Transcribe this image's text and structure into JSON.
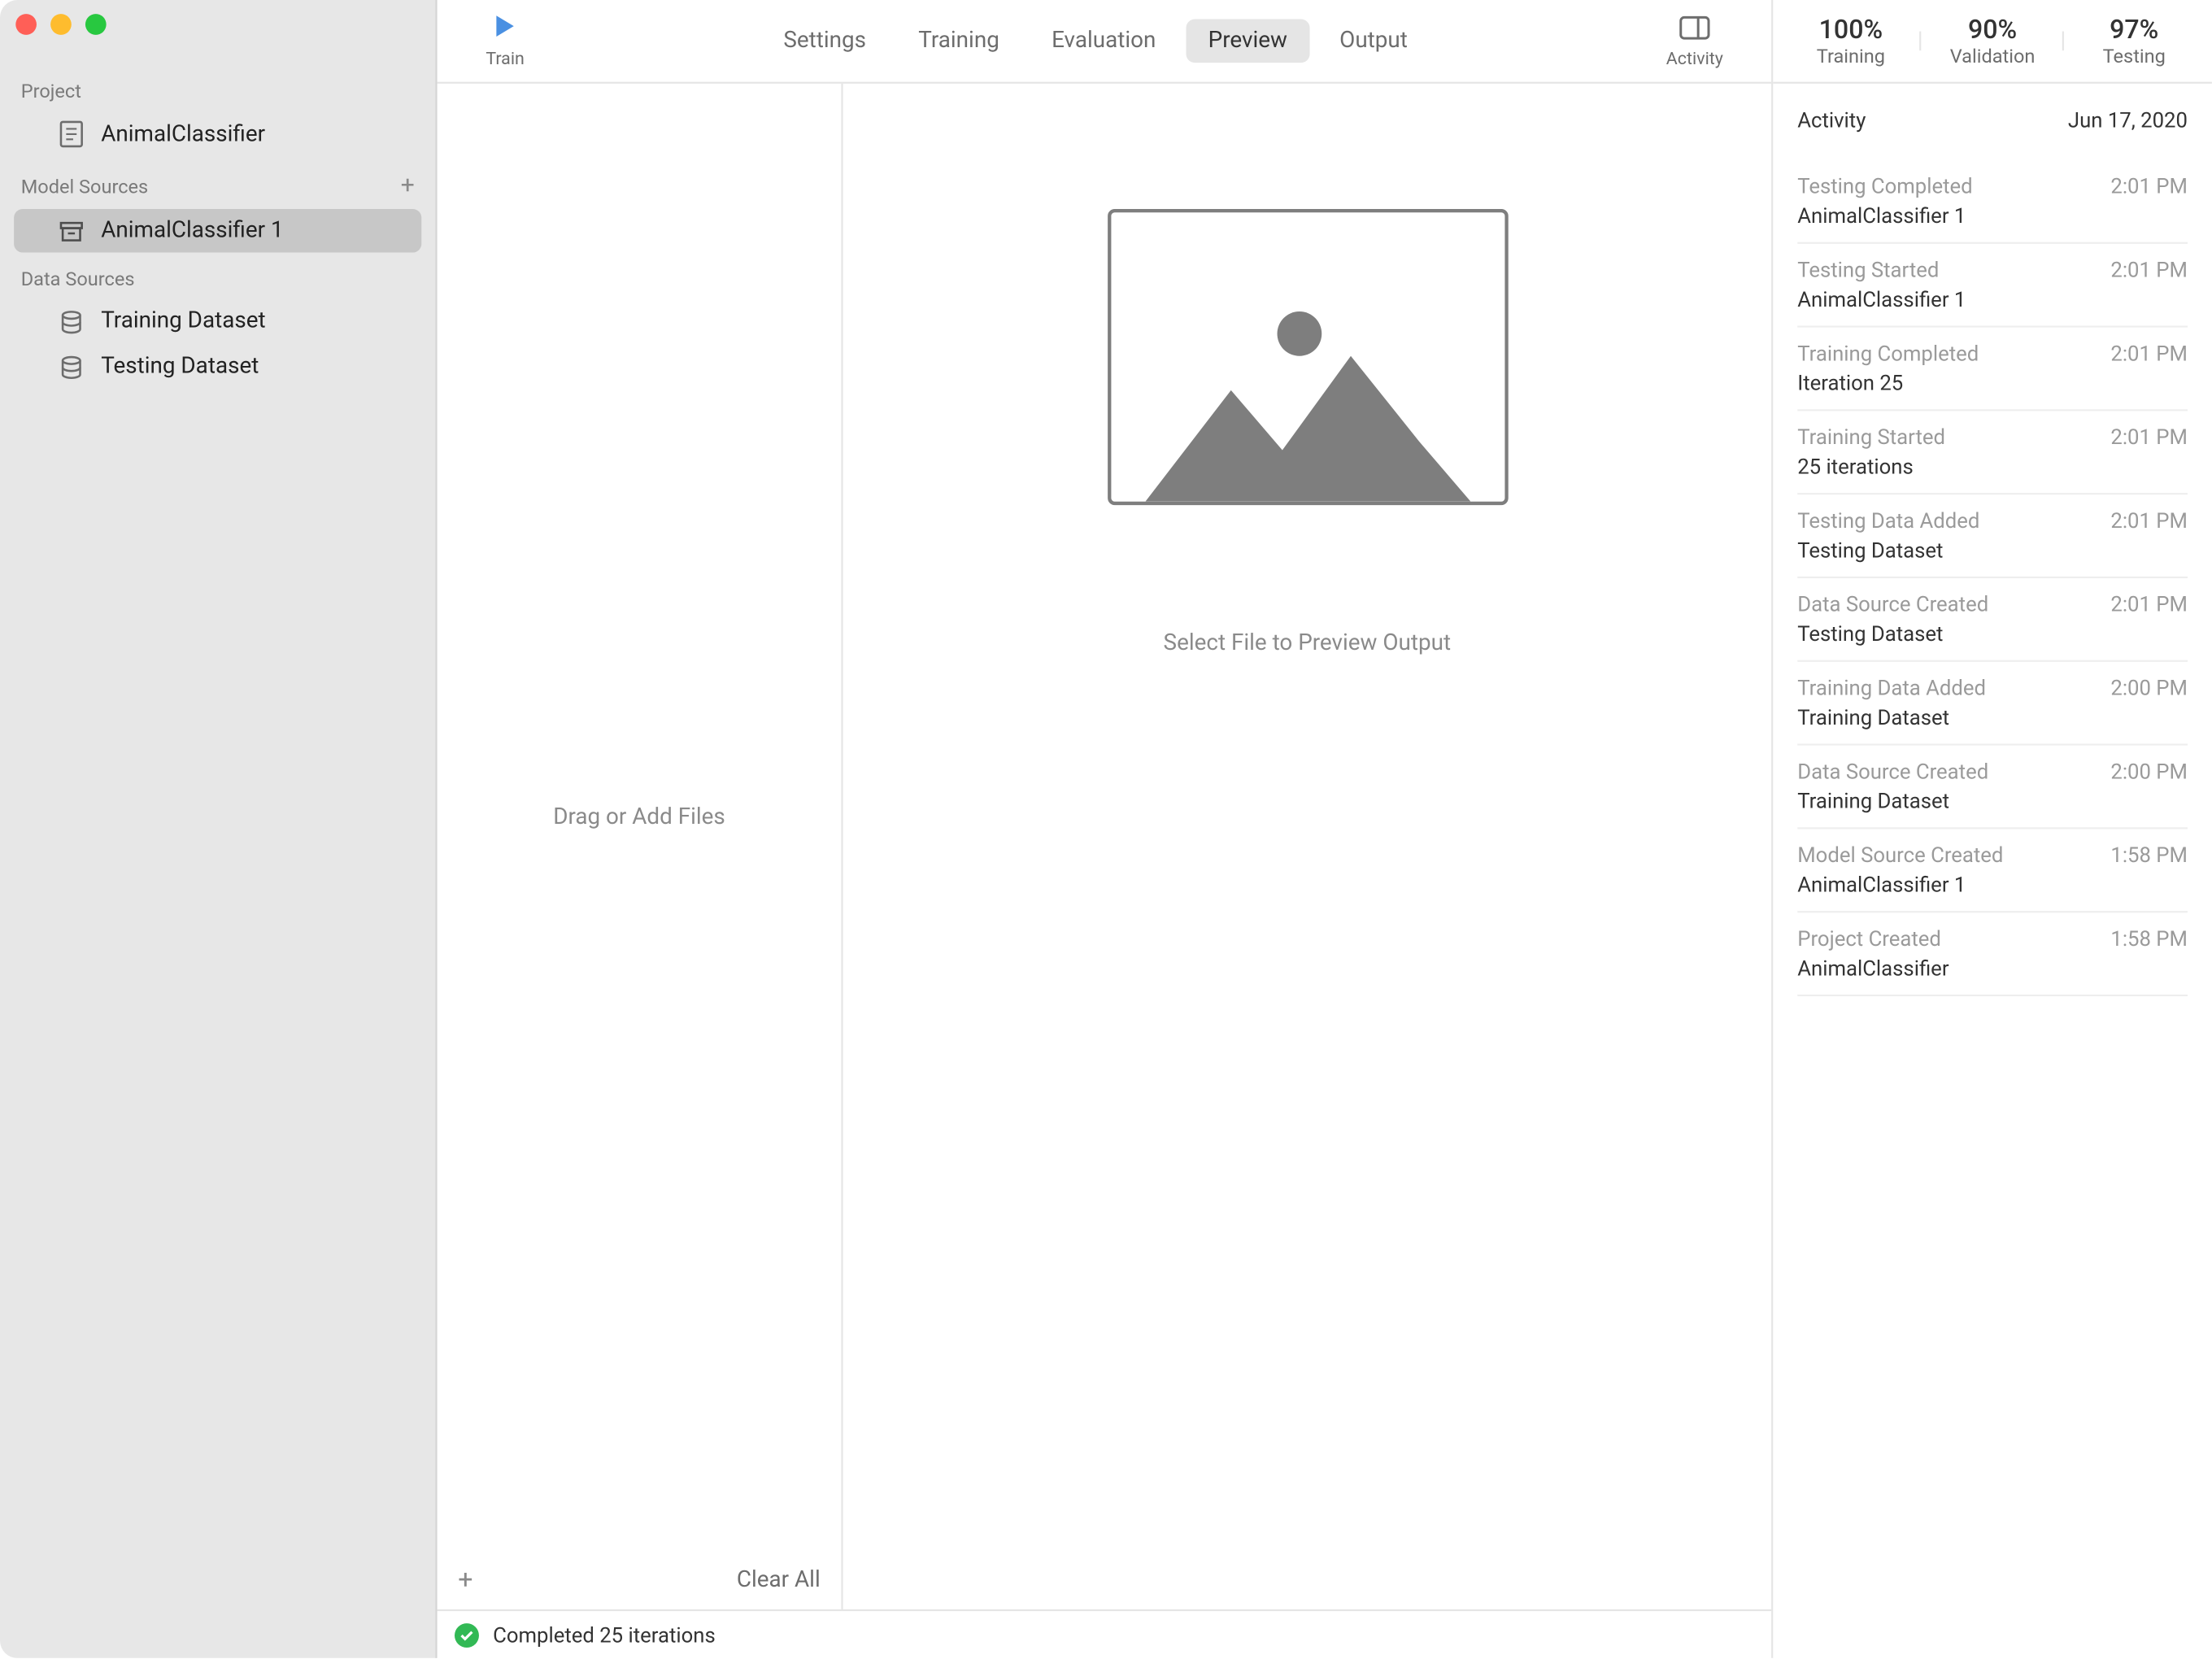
{
  "sidebar": {
    "sections": {
      "project": {
        "header": "Project",
        "item": "AnimalClassifier"
      },
      "model_sources": {
        "header": "Model Sources",
        "item": "AnimalClassifier 1"
      },
      "data_sources": {
        "header": "Data Sources",
        "items": [
          "Training Dataset",
          "Testing Dataset"
        ]
      }
    }
  },
  "toolbar": {
    "train_label": "Train",
    "tabs": [
      "Settings",
      "Training",
      "Evaluation",
      "Preview",
      "Output"
    ],
    "active_tab": "Preview",
    "activity_label": "Activity"
  },
  "drop_panel": {
    "placeholder": "Drag or Add Files",
    "clear_all": "Clear All"
  },
  "preview": {
    "placeholder_text": "Select File to Preview Output"
  },
  "metrics": [
    {
      "value": "100%",
      "label": "Training"
    },
    {
      "value": "90%",
      "label": "Validation"
    },
    {
      "value": "97%",
      "label": "Testing"
    }
  ],
  "activity": {
    "header": "Activity",
    "date": "Jun 17, 2020",
    "items": [
      {
        "title": "Testing Completed",
        "time": "2:01 PM",
        "detail": "AnimalClassifier 1"
      },
      {
        "title": "Testing Started",
        "time": "2:01 PM",
        "detail": "AnimalClassifier 1"
      },
      {
        "title": "Training Completed",
        "time": "2:01 PM",
        "detail": "Iteration 25"
      },
      {
        "title": "Training Started",
        "time": "2:01 PM",
        "detail": "25 iterations"
      },
      {
        "title": "Testing Data Added",
        "time": "2:01 PM",
        "detail": "Testing Dataset"
      },
      {
        "title": "Data Source Created",
        "time": "2:01 PM",
        "detail": "Testing Dataset"
      },
      {
        "title": "Training Data Added",
        "time": "2:00 PM",
        "detail": "Training Dataset"
      },
      {
        "title": "Data Source Created",
        "time": "2:00 PM",
        "detail": "Training Dataset"
      },
      {
        "title": "Model Source Created",
        "time": "1:58 PM",
        "detail": "AnimalClassifier 1"
      },
      {
        "title": "Project Created",
        "time": "1:58 PM",
        "detail": "AnimalClassifier"
      }
    ]
  },
  "status": {
    "text": "Completed 25 iterations"
  }
}
